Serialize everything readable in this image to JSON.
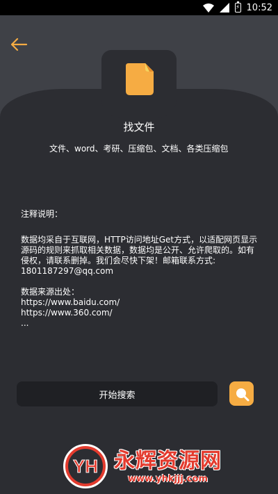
{
  "status_bar": {
    "time": "10:52",
    "icons": [
      "wifi-icon",
      "signal-icon",
      "battery-icon"
    ]
  },
  "header": {
    "back_icon": "arrow-left-icon"
  },
  "app": {
    "icon": "document-icon",
    "title": "找文件",
    "subtitle": "文件、word、考研、压缩包、文档、各类压缩包"
  },
  "notes": {
    "heading": "注释说明：",
    "body": "数据均采自于互联网，HTTP访问地址Get方式，以适配网页显示源码的规则来抓取相关数据，数据均是公开、允许爬取的。如有侵权，请联系删掉。我们会尽快下架！邮箱联系方式: 1801187297@qq.com",
    "sources_heading": "数据来源出处：",
    "sources": [
      "https://www.baidu.com/",
      "https://www.360.com/",
      "..."
    ]
  },
  "actions": {
    "search_label": "开始搜索",
    "search_icon": "search-icon"
  },
  "watermark": {
    "logo_text": "YH",
    "name": "永辉资源网",
    "url": "www.yhkjjj.com"
  },
  "colors": {
    "accent": "#f6ac43",
    "background": "#3f4147",
    "panel": "#2c2d32",
    "button": "#1f2024",
    "watermark": "#e33b2e"
  }
}
